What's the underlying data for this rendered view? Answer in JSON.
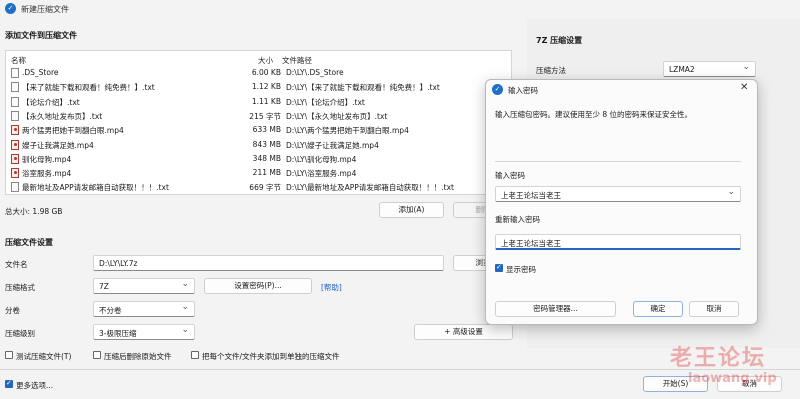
{
  "window": {
    "title": "新建压缩文件"
  },
  "files_section": {
    "title": "添加文件到压缩文件",
    "headers": {
      "name": "名称",
      "size": "大小",
      "path": "文件路径"
    },
    "rows": [
      {
        "name": ".DS_Store",
        "size": "6.00 KB",
        "path": "D:\\LY\\.DS_Store",
        "icon": "file-icon"
      },
      {
        "name": "【来了就能下载和观看！纯免费！】.txt",
        "size": "1.12 KB",
        "path": "D:\\LY\\【来了就能下载和观看！纯免费！】.txt",
        "icon": "file-icon"
      },
      {
        "name": "【论坛介绍】.txt",
        "size": "1.11 KB",
        "path": "D:\\LY\\【论坛介绍】.txt",
        "icon": "file-icon"
      },
      {
        "name": "【永久地址发布页】.txt",
        "size": "215 字节",
        "path": "D:\\LY\\【永久地址发布页】.txt",
        "icon": "file-icon"
      },
      {
        "name": "两个猛男把她干到翻白眼.mp4",
        "size": "633 MB",
        "path": "D:\\LY\\两个猛男把她干到翻白眼.mp4",
        "icon": "video-icon"
      },
      {
        "name": "嫂子让我满足她.mp4",
        "size": "843 MB",
        "path": "D:\\LY\\嫂子让我满足她.mp4",
        "icon": "video-icon"
      },
      {
        "name": "驯化母狗.mp4",
        "size": "348 MB",
        "path": "D:\\LY\\驯化母狗.mp4",
        "icon": "video-icon"
      },
      {
        "name": "浴室服务.mp4",
        "size": "211 MB",
        "path": "D:\\LY\\浴室服务.mp4",
        "icon": "video-icon"
      },
      {
        "name": "最新地址及APP请发邮箱自动获取！！！.txt",
        "size": "669 字节",
        "path": "D:\\LY\\最新地址及APP请发邮箱自动获取！！！.txt",
        "icon": "file-icon"
      }
    ],
    "total_size": "总大小: 1.98 GB",
    "add_button": "添加(A)",
    "delete_button": "删除"
  },
  "settings_section": {
    "title": "压缩文件设置",
    "filename_label": "文件名",
    "filename_value": "D:\\LY\\LY.7z",
    "browse_button": "浏览",
    "format_label": "压缩格式",
    "format_value": "7Z",
    "set_password_button": "设置密码(P)...",
    "help_link": "[帮助]",
    "split_label": "分卷",
    "split_value": "不分卷",
    "level_label": "压缩级别",
    "level_value": "3-极限压缩",
    "advanced_button": "+ 高级设置",
    "checkboxes": [
      {
        "label": "测试压缩文件(T)",
        "checked": false
      },
      {
        "label": "压缩后删除原始文件",
        "checked": false
      },
      {
        "label": "把每个文件/文件夹添加到单独的压缩文件",
        "checked": false
      }
    ]
  },
  "right_panel": {
    "title": "7Z 压缩设置",
    "method_label": "压缩方法",
    "method_value": "LZMA2"
  },
  "footer": {
    "more_options": "更多选项...",
    "more_options_checked": true,
    "start_button": "开始(S)",
    "cancel_button": "取消"
  },
  "password_dialog": {
    "title": "输入密码",
    "description": "输入压缩包密码。建议使用至少 8 位的密码来保证安全性。",
    "password_label": "输入密码",
    "password_value": "上老王论坛当老王",
    "confirm_label": "重新输入密码",
    "confirm_value": "上老王论坛当老王",
    "show_password_label": "显示密码",
    "show_password_checked": true,
    "manager_button": "密码管理器...",
    "ok_button": "确定",
    "cancel_button": "取消"
  },
  "watermark": {
    "text": "老王论坛",
    "url": "laowang.vip"
  },
  "colors": {
    "accent": "#2367c1",
    "link": "#1e5fbf",
    "watermark": "#dc2828"
  }
}
